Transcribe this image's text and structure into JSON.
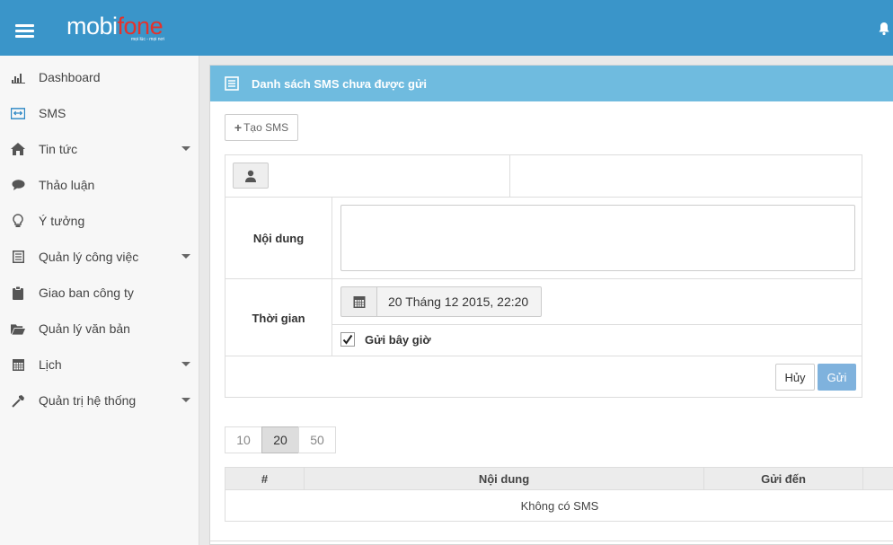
{
  "header": {
    "logo_main": "mobi",
    "logo_accent": "fone",
    "logo_tagline": "mọi lúc - mọi nơi",
    "menu_icon": "hamburger-icon",
    "notification_icon": "bell-icon"
  },
  "sidebar": {
    "items": [
      {
        "label": "Dashboard",
        "icon": "bar-chart-icon",
        "has_submenu": false
      },
      {
        "label": "SMS",
        "icon": "sms-icon",
        "has_submenu": false
      },
      {
        "label": "Tin tức",
        "icon": "home-icon",
        "has_submenu": true
      },
      {
        "label": "Thảo luận",
        "icon": "comment-icon",
        "has_submenu": false
      },
      {
        "label": "Ý tưởng",
        "icon": "lightbulb-icon",
        "has_submenu": false
      },
      {
        "label": "Quản lý công việc",
        "icon": "list-icon",
        "has_submenu": true
      },
      {
        "label": "Giao ban công ty",
        "icon": "clipboard-icon",
        "has_submenu": false
      },
      {
        "label": "Quản lý văn bản",
        "icon": "folder-open-icon",
        "has_submenu": false
      },
      {
        "label": "Lịch",
        "icon": "calendar-icon",
        "has_submenu": true
      },
      {
        "label": "Quản trị hệ thống",
        "icon": "hammer-icon",
        "has_submenu": true
      }
    ]
  },
  "panel": {
    "title": "Danh sách SMS chưa được gửi",
    "create_button": "Tạo SMS",
    "form": {
      "content_label": "Nội dung",
      "content_value": "",
      "time_label": "Thời gian",
      "time_value": "20 Tháng 12 2015, 22:20",
      "send_now_label": "Gửi bây giờ",
      "send_now_checked": true,
      "cancel_button": "Hủy",
      "send_button": "Gửi"
    },
    "page_sizes": [
      "10",
      "20",
      "50"
    ],
    "page_size_selected": "20",
    "table": {
      "columns": [
        "#",
        "Nội dung",
        "Gửi đến",
        ""
      ],
      "empty_message": "Không có SMS"
    }
  },
  "colors": {
    "topbar": "#3a95c9",
    "panel_header": "#6fbbdf",
    "send_button": "#7fb2dd",
    "logo_accent": "#e4322b"
  }
}
